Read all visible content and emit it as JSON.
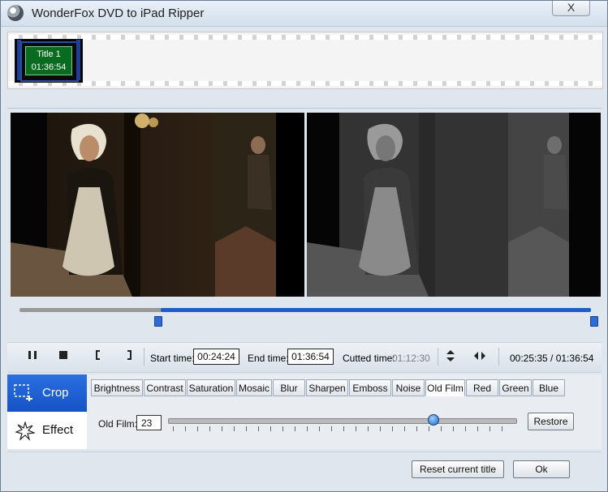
{
  "window": {
    "title": "WonderFox DVD to iPad Ripper",
    "close_label": "X"
  },
  "titles": [
    {
      "label": "Title 1",
      "duration": "01:36:54"
    }
  ],
  "controls": {
    "start_time_label": "Start time:",
    "start_time_value": "00:24:24",
    "end_time_label": "End time:",
    "end_time_value": "01:36:54",
    "cutted_time_label": "Cutted time:",
    "cutted_time_value": "01:12:30",
    "position": "00:25:35 / 01:36:54"
  },
  "left_tabs": {
    "crop_label": "Crop",
    "effect_label": "Effect"
  },
  "effect_tabs": [
    "Brightness",
    "Contrast",
    "Saturation",
    "Mosaic",
    "Blur",
    "Sharpen",
    "Emboss",
    "Noise",
    "Old Film",
    "Red",
    "Green",
    "Blue"
  ],
  "effect_active": "Old Film",
  "effect": {
    "field_label": "Old Film:",
    "value": "23",
    "restore_label": "Restore",
    "slider_fraction": 0.76
  },
  "footer": {
    "reset_label": "Reset current title",
    "ok_label": "Ok"
  },
  "colors": {
    "accent": "#1f5ec8",
    "title_cell": "#086b1f"
  }
}
